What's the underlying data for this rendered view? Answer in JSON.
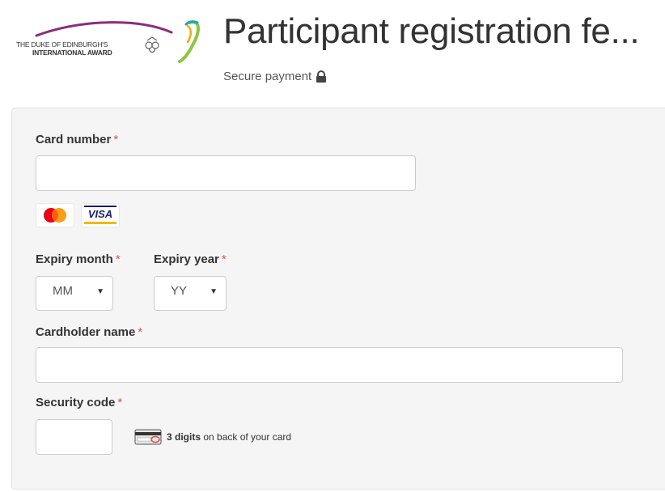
{
  "header": {
    "logo_line1": "THE DUKE OF EDINBURGH'S",
    "logo_line2": "INTERNATIONAL AWARD",
    "title": "Participant registration fe...",
    "secure_label": "Secure payment"
  },
  "form": {
    "card_number": {
      "label": "Card number",
      "required": "*",
      "value": ""
    },
    "accepted_cards": [
      "mastercard-icon",
      "visa-icon"
    ],
    "visa_text": "VISA",
    "expiry_month": {
      "label": "Expiry month",
      "required": "*",
      "selected": "MM"
    },
    "expiry_year": {
      "label": "Expiry year",
      "required": "*",
      "selected": "YY"
    },
    "cardholder_name": {
      "label": "Cardholder name",
      "required": "*",
      "value": ""
    },
    "security_code": {
      "label": "Security code",
      "required": "*",
      "value": ""
    },
    "security_hint_bold": "3 digits",
    "security_hint_rest": " on back of your card"
  },
  "colors": {
    "required": "#d9534f",
    "panel_bg": "#f5f5f5",
    "logo_purple": "#8b2c7a",
    "logo_green": "#8dc63f"
  }
}
